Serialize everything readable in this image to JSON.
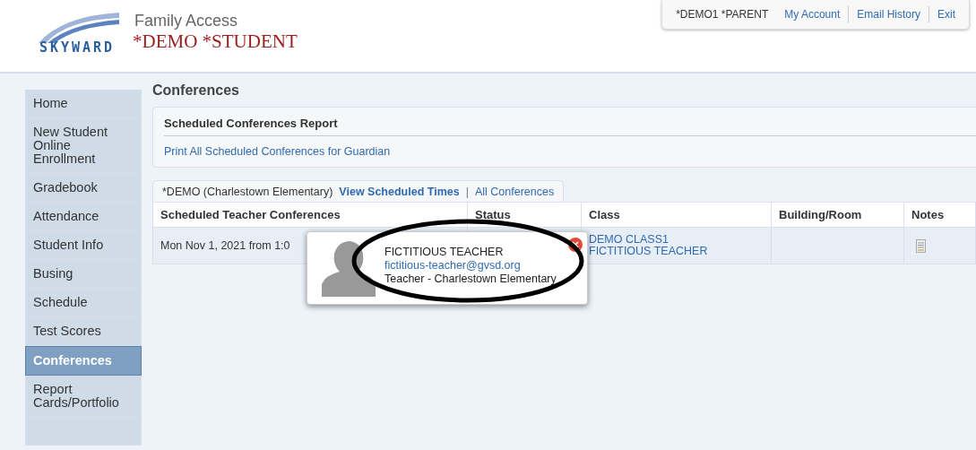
{
  "header": {
    "product": "Family Access",
    "student": "*DEMO *STUDENT",
    "logo_text": "SKYWARD"
  },
  "account_bar": [
    {
      "label": "*DEMO1 *PARENT",
      "kind": "text"
    },
    {
      "label": "My Account",
      "kind": "link"
    },
    {
      "label": "Email History",
      "kind": "link"
    },
    {
      "label": "Exit",
      "kind": "link"
    }
  ],
  "sidebar": {
    "items": [
      {
        "label": "Home",
        "selected": false
      },
      {
        "label": "New Student Online Enrollment",
        "selected": false
      },
      {
        "label": "Gradebook",
        "selected": false
      },
      {
        "label": "Attendance",
        "selected": false
      },
      {
        "label": "Student Info",
        "selected": false
      },
      {
        "label": "Busing",
        "selected": false
      },
      {
        "label": "Schedule",
        "selected": false
      },
      {
        "label": "Test Scores",
        "selected": false
      },
      {
        "label": "Conferences",
        "selected": true
      },
      {
        "label": "Report Cards/Portfolio",
        "selected": false
      }
    ]
  },
  "page_title": "Conferences",
  "report": {
    "title": "Scheduled Conferences Report",
    "link": "Print All Scheduled Conferences for Guardian"
  },
  "tabs": {
    "school": "*DEMO (Charlestown Elementary)",
    "items": [
      {
        "label": "View Scheduled Times",
        "selected": true
      },
      {
        "label": "All Conferences",
        "selected": false
      }
    ],
    "separator": "|"
  },
  "table": {
    "columns": [
      "Scheduled Teacher Conferences",
      "Status",
      "Class",
      "Building/Room",
      "Notes"
    ],
    "rows": [
      {
        "conference": "Mon Nov 1, 2021 from 1:0",
        "class_name": "DEMO CLASS1",
        "teacher": "FICTITIOUS TEACHER"
      }
    ]
  },
  "popup": {
    "name": "FICTITIOUS TEACHER",
    "email": "fictitious-teacher@gvsd.org",
    "role": "Teacher - Charlestown Elementary"
  }
}
